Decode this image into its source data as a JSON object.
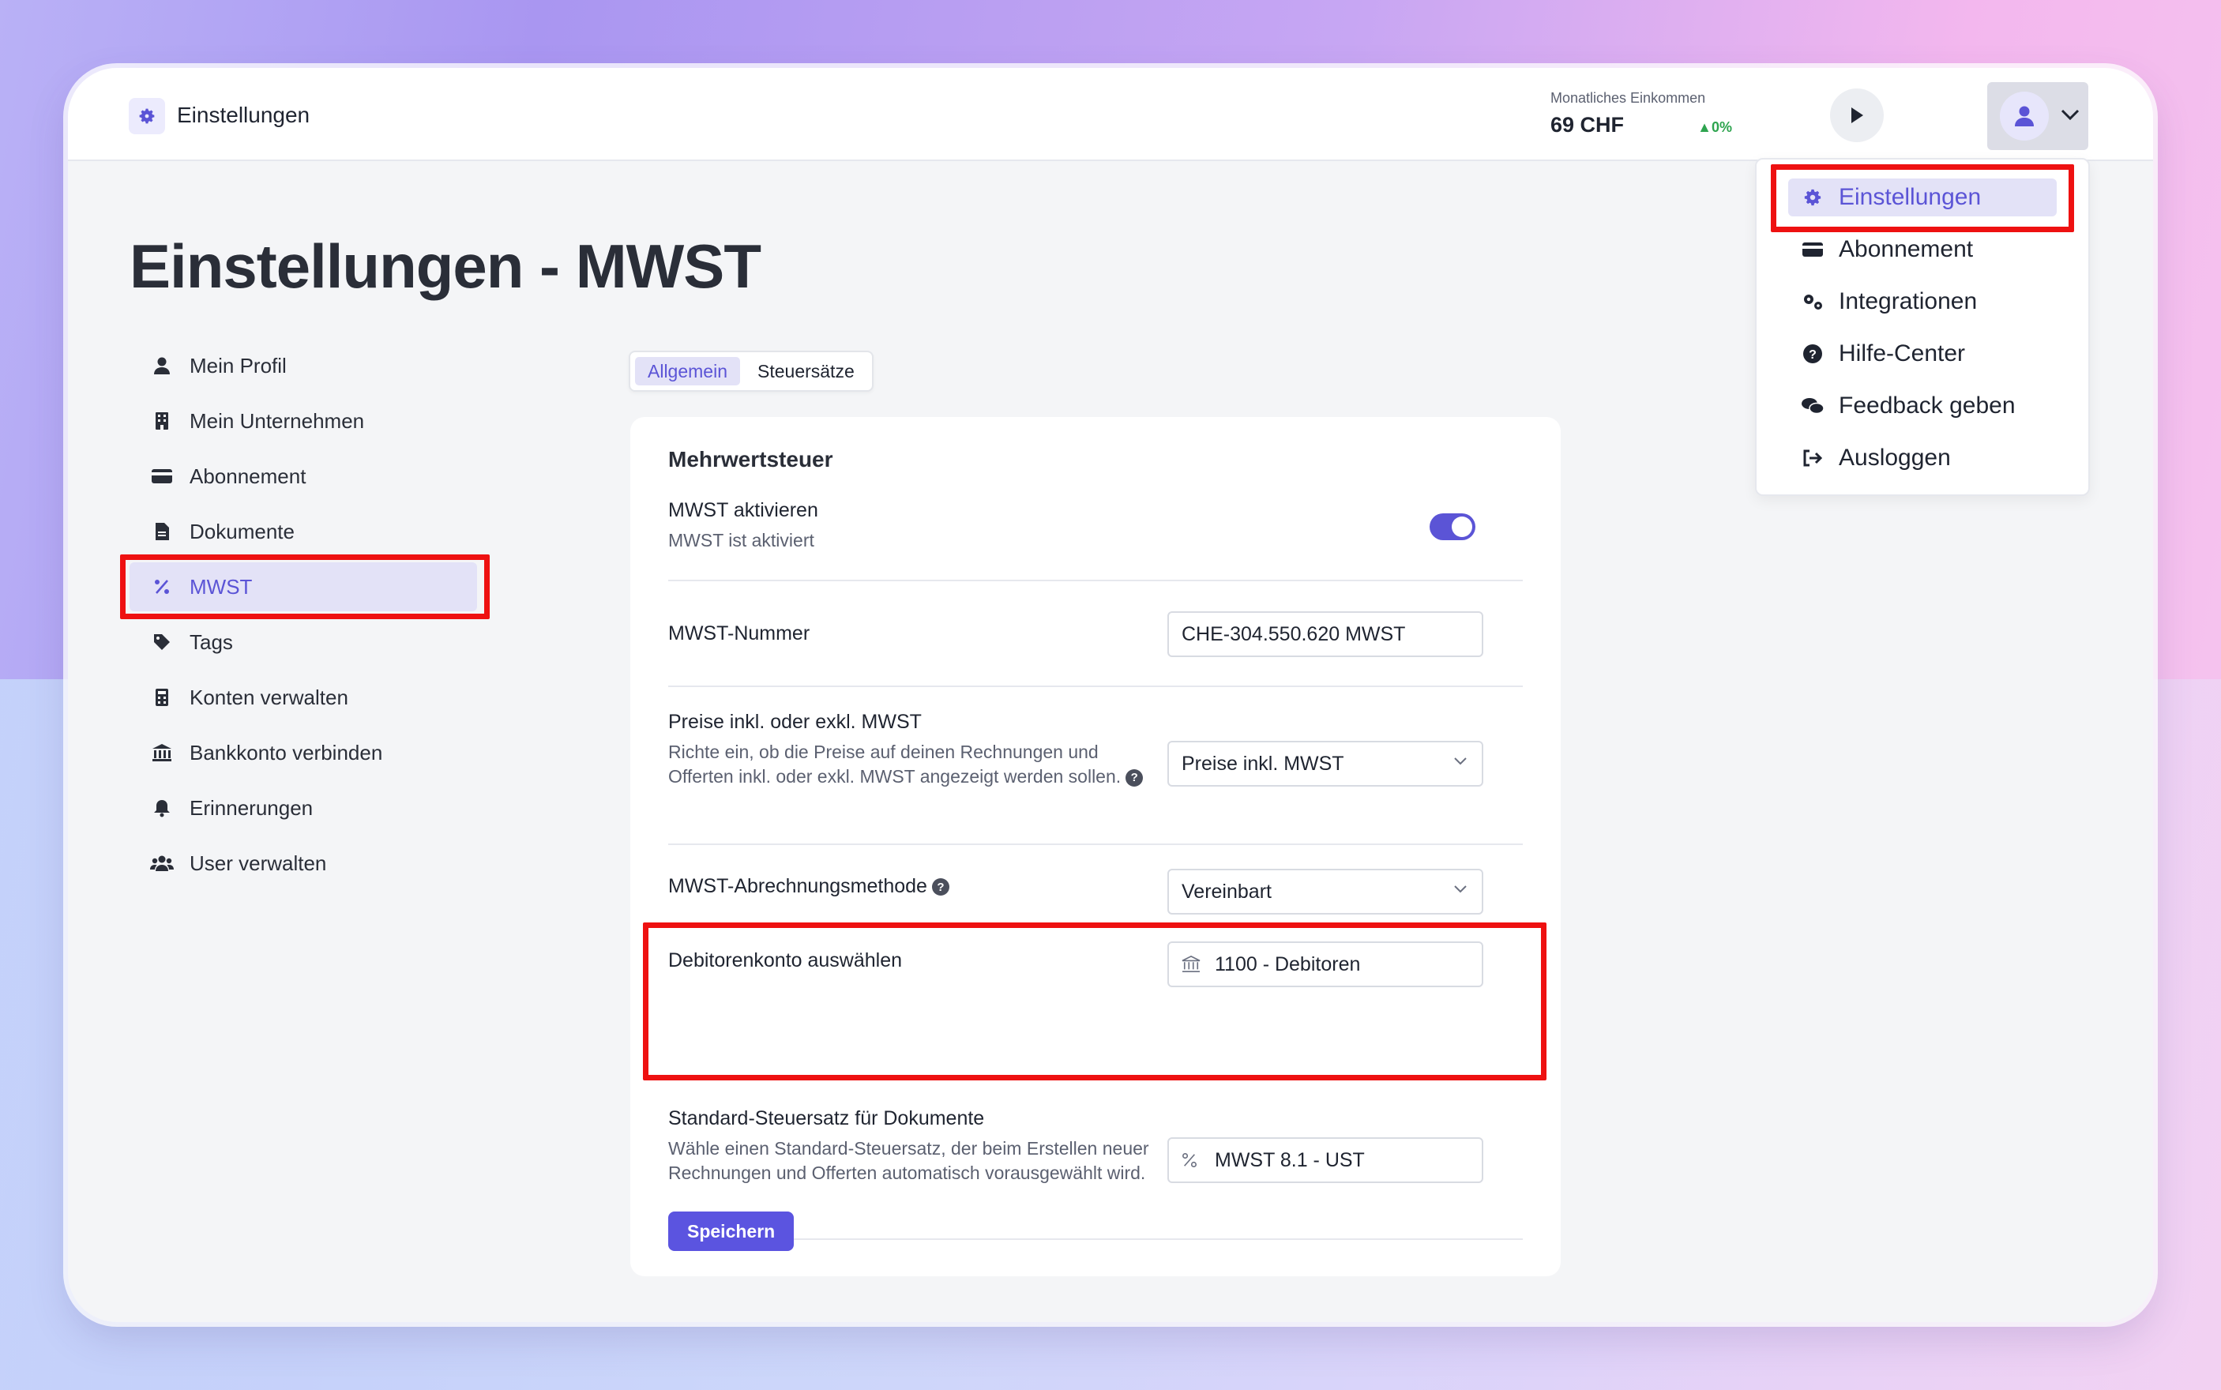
{
  "app": {
    "title": "Einstellungen"
  },
  "header": {
    "income_label": "Monatliches Einkommen",
    "income_value": "69 CHF",
    "income_change": "0%"
  },
  "page": {
    "title": "Einstellungen - MWST"
  },
  "sidebar": {
    "items": [
      {
        "label": "Mein Profil",
        "icon": "user-icon"
      },
      {
        "label": "Mein Unternehmen",
        "icon": "building-icon"
      },
      {
        "label": "Abonnement",
        "icon": "credit-card-icon"
      },
      {
        "label": "Dokumente",
        "icon": "document-icon"
      },
      {
        "label": "MWST",
        "icon": "percent-icon",
        "active": true
      },
      {
        "label": "Tags",
        "icon": "tag-icon"
      },
      {
        "label": "Konten verwalten",
        "icon": "calculator-icon"
      },
      {
        "label": "Bankkonto verbinden",
        "icon": "bank-icon"
      },
      {
        "label": "Erinnerungen",
        "icon": "bell-icon"
      },
      {
        "label": "User verwalten",
        "icon": "users-icon"
      }
    ]
  },
  "tabs": [
    {
      "label": "Allgemein",
      "active": true
    },
    {
      "label": "Steuersätze",
      "active": false
    }
  ],
  "card": {
    "title": "Mehrwertsteuer",
    "mwst_toggle": {
      "label": "MWST aktivieren",
      "sub": "MWST ist aktiviert",
      "enabled": true
    },
    "mwst_number": {
      "label": "MWST-Nummer",
      "value": "CHE-304.550.620 MWST"
    },
    "prices": {
      "label": "Preise inkl. oder exkl. MWST",
      "sub": "Richte ein, ob die Preise auf deinen Rechnungen und Offerten inkl. oder exkl. MWST angezeigt werden sollen.",
      "value": "Preise inkl. MWST"
    },
    "method": {
      "label": "MWST-Abrechnungsmethode",
      "value": "Vereinbart"
    },
    "debtor": {
      "label": "Debitorenkonto auswählen",
      "value": "1100 - Debitoren"
    },
    "default_rate": {
      "label": "Standard-Steuersatz für Dokumente",
      "sub": "Wähle einen Standard-Steuersatz, der beim Erstellen neuer Rechnungen und Offerten automatisch vorausgewählt wird.",
      "value": "MWST 8.1 - UST"
    },
    "save_label": "Speichern"
  },
  "user_menu": {
    "items": [
      {
        "label": "Einstellungen",
        "icon": "gear-icon",
        "active": true
      },
      {
        "label": "Abonnement",
        "icon": "credit-card-icon"
      },
      {
        "label": "Integrationen",
        "icon": "gears-icon"
      },
      {
        "label": "Hilfe-Center",
        "icon": "question-icon"
      },
      {
        "label": "Feedback geben",
        "icon": "comments-icon"
      },
      {
        "label": "Ausloggen",
        "icon": "logout-icon"
      }
    ]
  },
  "colors": {
    "accent": "#5b54d6",
    "highlight": "#ee1111",
    "positive": "#2ea44f"
  }
}
